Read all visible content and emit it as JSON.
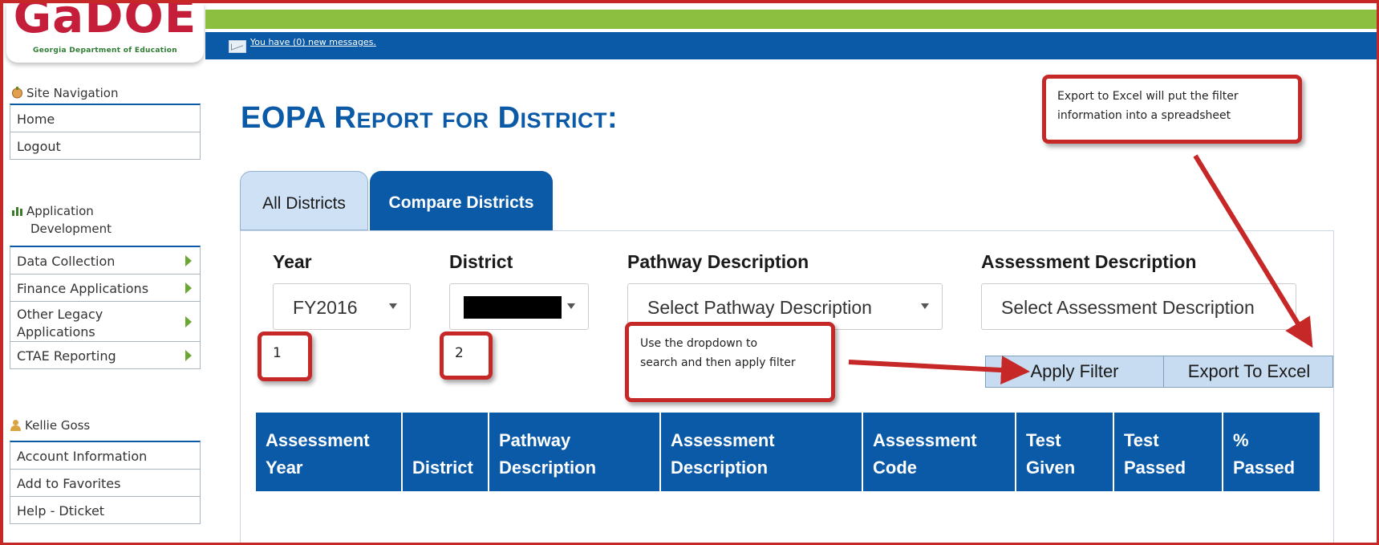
{
  "logo": {
    "text": "GaDOE",
    "subtitle": "Georgia Department of Education"
  },
  "header": {
    "messages_link": "You have (0) new messages."
  },
  "sidebar": {
    "nav_title": "Site Navigation",
    "nav_items": [
      "Home",
      "Logout"
    ],
    "app_title_line1": "Application",
    "app_title_line2": "Development",
    "app_items": [
      {
        "label": "Data Collection"
      },
      {
        "label": "Finance Applications"
      },
      {
        "label_line1": "Other Legacy",
        "label_line2": "Applications"
      },
      {
        "label": "CTAE Reporting"
      }
    ],
    "user_name": "Kellie Goss",
    "user_items": [
      "Account Information",
      "Add to Favorites",
      "Help - Dticket"
    ]
  },
  "main": {
    "title": "EOPA Report for District:",
    "tabs": [
      "All Districts",
      "Compare Districts"
    ],
    "filters": {
      "year_label": "Year",
      "year_value": "FY2016",
      "district_label": "District",
      "pathway_label": "Pathway Description",
      "pathway_placeholder": "Select Pathway Description",
      "assessment_label": "Assessment Description",
      "assessment_placeholder": "Select Assessment Description"
    },
    "buttons": {
      "apply": "Apply Filter",
      "export": "Export To Excel"
    },
    "table_headers": [
      [
        "Assessment",
        "Year"
      ],
      [
        "",
        "District"
      ],
      [
        "Pathway",
        "Description"
      ],
      [
        "Assessment",
        "Description"
      ],
      [
        "Assessment",
        "Code"
      ],
      [
        "Test",
        "Given"
      ],
      [
        "Test",
        "Passed"
      ],
      [
        "%",
        "Passed"
      ]
    ]
  },
  "annotations": {
    "marker_1": "1",
    "marker_2": "2",
    "dropdown_note_line1": "Use the dropdown to",
    "dropdown_note_line2": "search and then apply filter",
    "export_note_line1": "Export to Excel will put the filter",
    "export_note_line2": "information into a spreadsheet"
  },
  "colors": {
    "primary_blue": "#0b5aa8",
    "green_bar": "#8cbf3f",
    "annotation_red": "#c62828",
    "tab_light": "#cfe2f5"
  }
}
